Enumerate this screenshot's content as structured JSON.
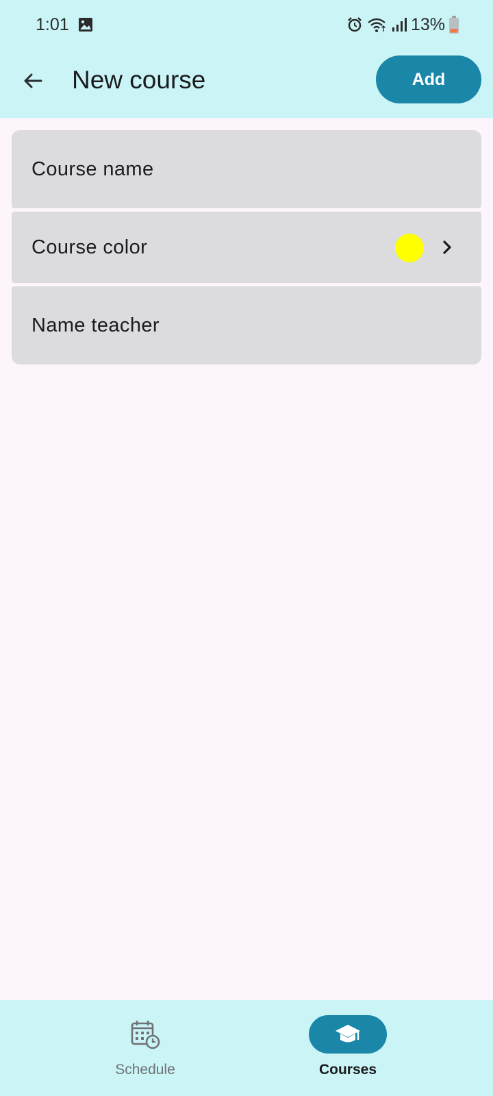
{
  "status_bar": {
    "time": "1:01",
    "battery": "13%",
    "icons": [
      "gallery-icon",
      "alarm-icon",
      "wifi-icon",
      "signal-icon",
      "battery-icon"
    ]
  },
  "app_bar": {
    "title": "New course",
    "add_label": "Add",
    "back_icon": "arrow-left-icon"
  },
  "form": {
    "course_name_placeholder": "Course name",
    "course_color_label": "Course color",
    "course_color_value": "#ffff00",
    "name_teacher_placeholder": "Name teacher"
  },
  "bottom_nav": {
    "items": [
      {
        "label": "Schedule",
        "icon": "calendar-clock-icon",
        "selected": false
      },
      {
        "label": "Courses",
        "icon": "graduation-cap-icon",
        "selected": true
      }
    ]
  },
  "colors": {
    "accent": "#1a86a8",
    "top_background": "#caf4f6",
    "page_background": "#fcf5fc",
    "field_background": "#dcdbde"
  }
}
